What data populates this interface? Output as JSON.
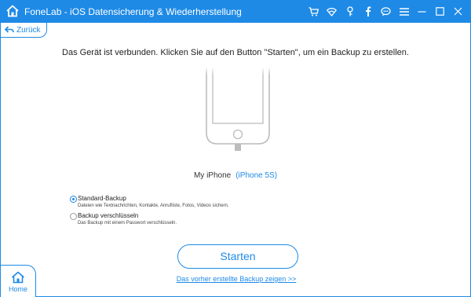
{
  "window": {
    "title": "FoneLab - iOS Datensicherung & Wiederherstellung",
    "accent_color": "#1e8ae6",
    "toolbar_icons": [
      "cart-icon",
      "wifi-icon",
      "key-icon",
      "facebook-icon",
      "chat-icon",
      "menu-icon",
      "minimize-icon",
      "maximize-icon",
      "close-icon"
    ]
  },
  "nav": {
    "back_label": "Zurück",
    "home_label": "Home"
  },
  "main": {
    "headline": "Das Gerät ist verbunden. Klicken Sie auf den Button \"Starten\", um ein Backup zu erstellen.",
    "device_name": "My iPhone",
    "device_model": "(iPhone 5S)"
  },
  "options": [
    {
      "title": "Standard-Backup",
      "description": "Dateien wie Textnachrichten, Kontakte, Anrufliste, Fotos, Videos sichern.",
      "selected": true
    },
    {
      "title": "Backup verschlüsseln",
      "description": "Das Backup mit einem Passwort verschlüsseln.",
      "selected": false
    }
  ],
  "actions": {
    "start_label": "Starten",
    "history_link": "Das vorher erstellte Backup zeigen >>"
  }
}
